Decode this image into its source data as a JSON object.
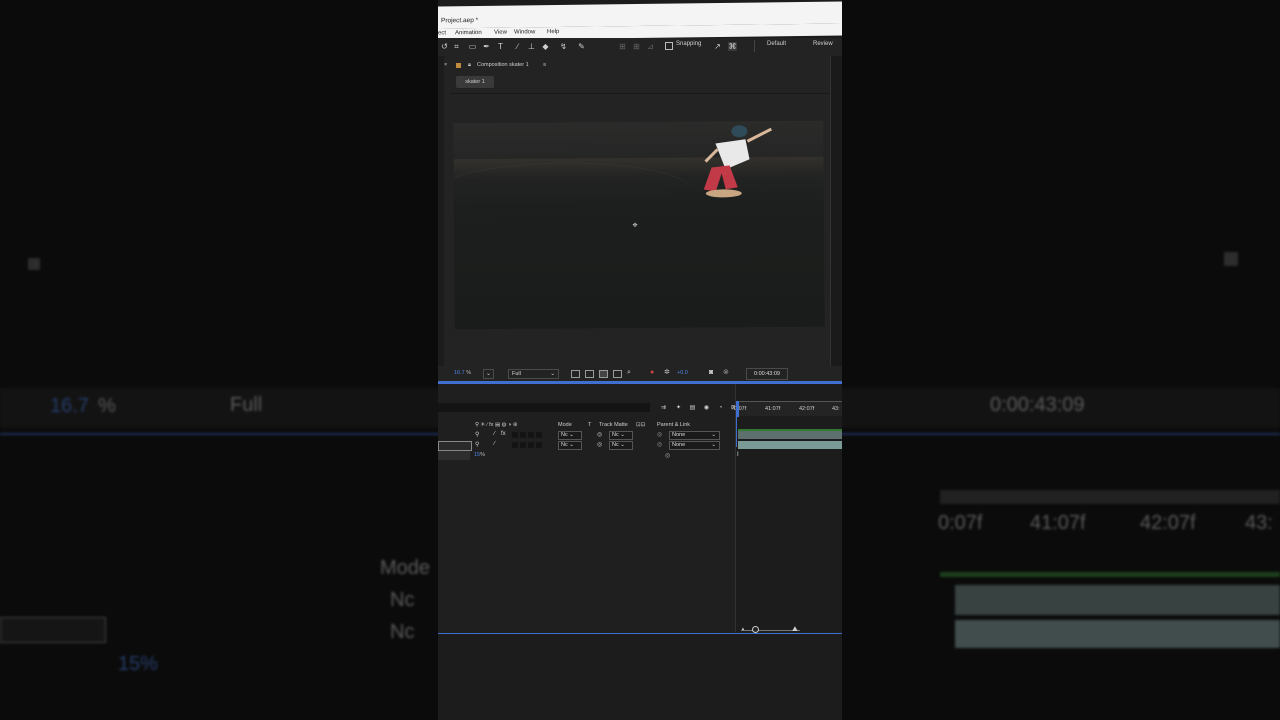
{
  "window": {
    "title": "Project.aep *"
  },
  "menu": [
    "ect",
    "Animation",
    "View",
    "Window",
    "Help"
  ],
  "toolbar": {
    "snapping_label": "Snapping",
    "workspaces": [
      "Default",
      "Review"
    ]
  },
  "composition": {
    "tab_label": "Composition skater 1",
    "flow_chip": "skater 1"
  },
  "viewer": {
    "zoom": "16.7",
    "zoom_unit": "%",
    "resolution": "Full",
    "exposure": "+0.0",
    "timecode": "0:00:43:09"
  },
  "timeline": {
    "columns": {
      "mode": "Mode",
      "t": "T",
      "track_matte": "Track Matte",
      "parent": "Parent & Link"
    },
    "layers": [
      {
        "mode": "Nc",
        "matte": "Nc",
        "parent": "None"
      },
      {
        "mode": "Nc",
        "matte": "Nc",
        "parent": "None"
      }
    ],
    "opacity_value": "15",
    "opacity_unit": "%",
    "ruler": [
      "0:07f",
      "41:07f",
      "42:07f",
      "43:"
    ]
  },
  "background": {
    "zoom": "16.7",
    "zoom_unit": "%",
    "resolution": "Full",
    "timecode": "0:00:43:09",
    "mode": "Mode",
    "mode_val": "Nc",
    "opacity": "15",
    "opacity_unit": "%",
    "ruler": [
      "0:07f",
      "41:07f",
      "42:07f",
      "43:"
    ]
  },
  "colors": {
    "accent_blue": "#3f6fd0",
    "layer_bar": "#7a9a96",
    "panel": "#232323"
  }
}
